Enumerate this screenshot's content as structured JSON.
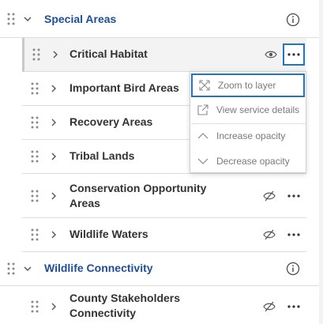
{
  "groups": [
    {
      "title": "Special Areas"
    },
    {
      "title": "Wildlife Connectivity"
    }
  ],
  "layers": [
    {
      "title": "Critical Habitat"
    },
    {
      "title": "Important Bird Areas"
    },
    {
      "title": "Recovery Areas"
    },
    {
      "title": "Tribal Lands"
    },
    {
      "title": "Conservation Opportunity Areas"
    },
    {
      "title": "Wildlife Waters"
    },
    {
      "title": "County Stakeholders Connectivity"
    }
  ],
  "context_menu": {
    "items": [
      {
        "label": "Zoom to layer",
        "icon": "zoom-to-extent-icon"
      },
      {
        "label": "View service details",
        "icon": "external-link-icon"
      },
      {
        "label": "Increase opacity",
        "icon": "chevron-up-icon"
      },
      {
        "label": "Decrease opacity",
        "icon": "chevron-down-icon"
      }
    ]
  },
  "colors": {
    "group_title": "#1f4e96",
    "focus_ring": "#1f75c3",
    "selected_row_bg": "#f3f3f3"
  }
}
